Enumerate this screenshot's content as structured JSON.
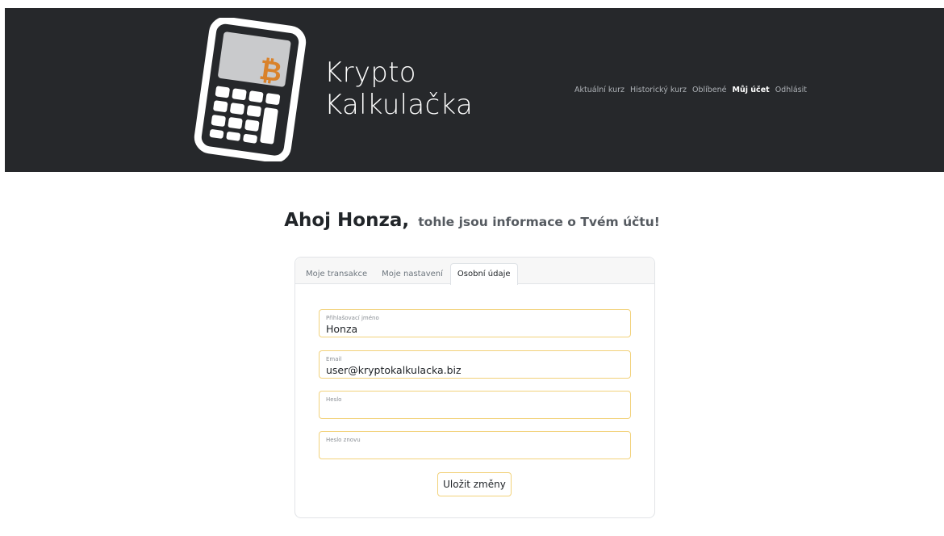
{
  "brand": {
    "line1": "Krypto",
    "line2": "Kalkulačka"
  },
  "nav": [
    {
      "label": "Aktuální kurz"
    },
    {
      "label": "Historický kurz"
    },
    {
      "label": "Oblíbené"
    },
    {
      "label": "Můj účet",
      "active": true
    },
    {
      "label": "Odhlásit"
    }
  ],
  "greeting": {
    "name": "Ahoj Honza,",
    "rest": "tohle jsou informace o Tvém účtu!"
  },
  "tabs": [
    {
      "label": "Moje transakce"
    },
    {
      "label": "Moje nastavení"
    },
    {
      "label": "Osobní údaje",
      "active": true
    }
  ],
  "form": {
    "username": {
      "label": "Přihlašovací jméno",
      "value": "Honza"
    },
    "email": {
      "label": "Email",
      "value": "user@kryptokalkulacka.biz"
    },
    "password": {
      "label": "Heslo",
      "value": ""
    },
    "password_again": {
      "label": "Heslo znovu",
      "value": ""
    },
    "save_label": "Uložit změny"
  },
  "colors": {
    "header_bg": "#26282b",
    "accent": "#f2d27b",
    "bitcoin": "#d9822b"
  },
  "icons": {
    "logo": "calculator-bitcoin-icon"
  }
}
